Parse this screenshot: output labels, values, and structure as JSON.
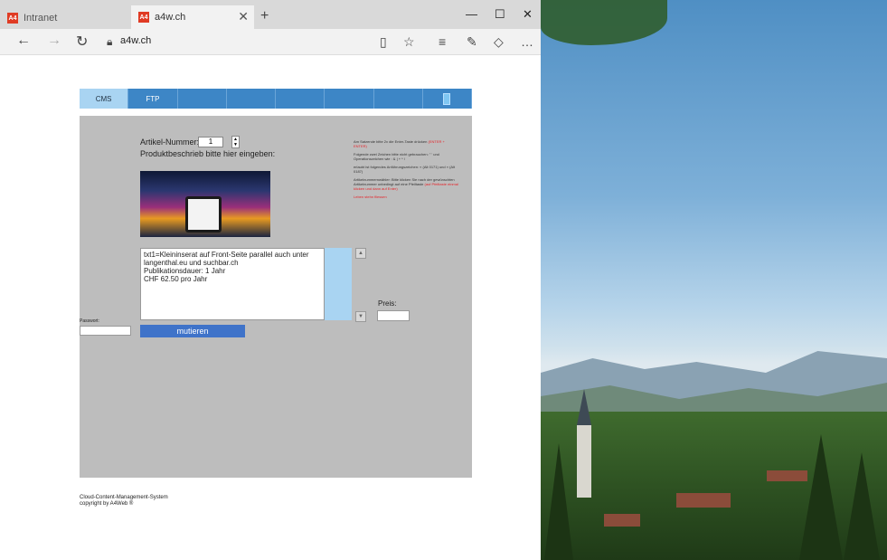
{
  "browser": {
    "tabs": [
      {
        "label": "Intranet",
        "active": false
      },
      {
        "label": "a4w.ch",
        "active": true
      }
    ],
    "url": "a4w.ch",
    "accent": "#e03b24"
  },
  "nav": {
    "items": [
      "CMS",
      "FTP"
    ]
  },
  "form": {
    "artikel_label": "Artikel-Nummer:",
    "artikel_value": "1",
    "produkt_label": "Produktbeschrieb bitte hier eingeben:",
    "description_text": "txt1=Kleininserat auf Front-Seite parallel auch unter langenthal.eu und suchbar.ch\nPublikationsdauer: 1 Jahr\nCHF 62.50 pro Jahr",
    "preis_label": "Preis:",
    "passwort_label": "Passwort:",
    "mutieren_label": "mutieren"
  },
  "notes": {
    "n1_prefix": "Am Satzende bitte 2x die Enter-Taste drücken",
    "n1_red": "(ENTER + ENTER)",
    "n2": "Folgende zwei Zeichen bitte nicht gebrauchen: \" ' und Operationszeichen wie : & | + * /",
    "n3": "erlaubt ist folgendes Anführungszeichen: « (Alt 0171) und » (Alt 0187)",
    "n4_prefix": "Artikelnummernwähler: Bitte klicken Sie nach der gewünschten Artikelnummer unbedingt auf eine Pfeiltaste",
    "n4_red": "(auf Pfeiltaste einmal klicken und dann auf Enter)",
    "n5_red": "Leben stehn fliessen"
  },
  "footer": {
    "line1": "Cloud-Content-Management-System",
    "line2": "copyright by A4Web ®"
  }
}
